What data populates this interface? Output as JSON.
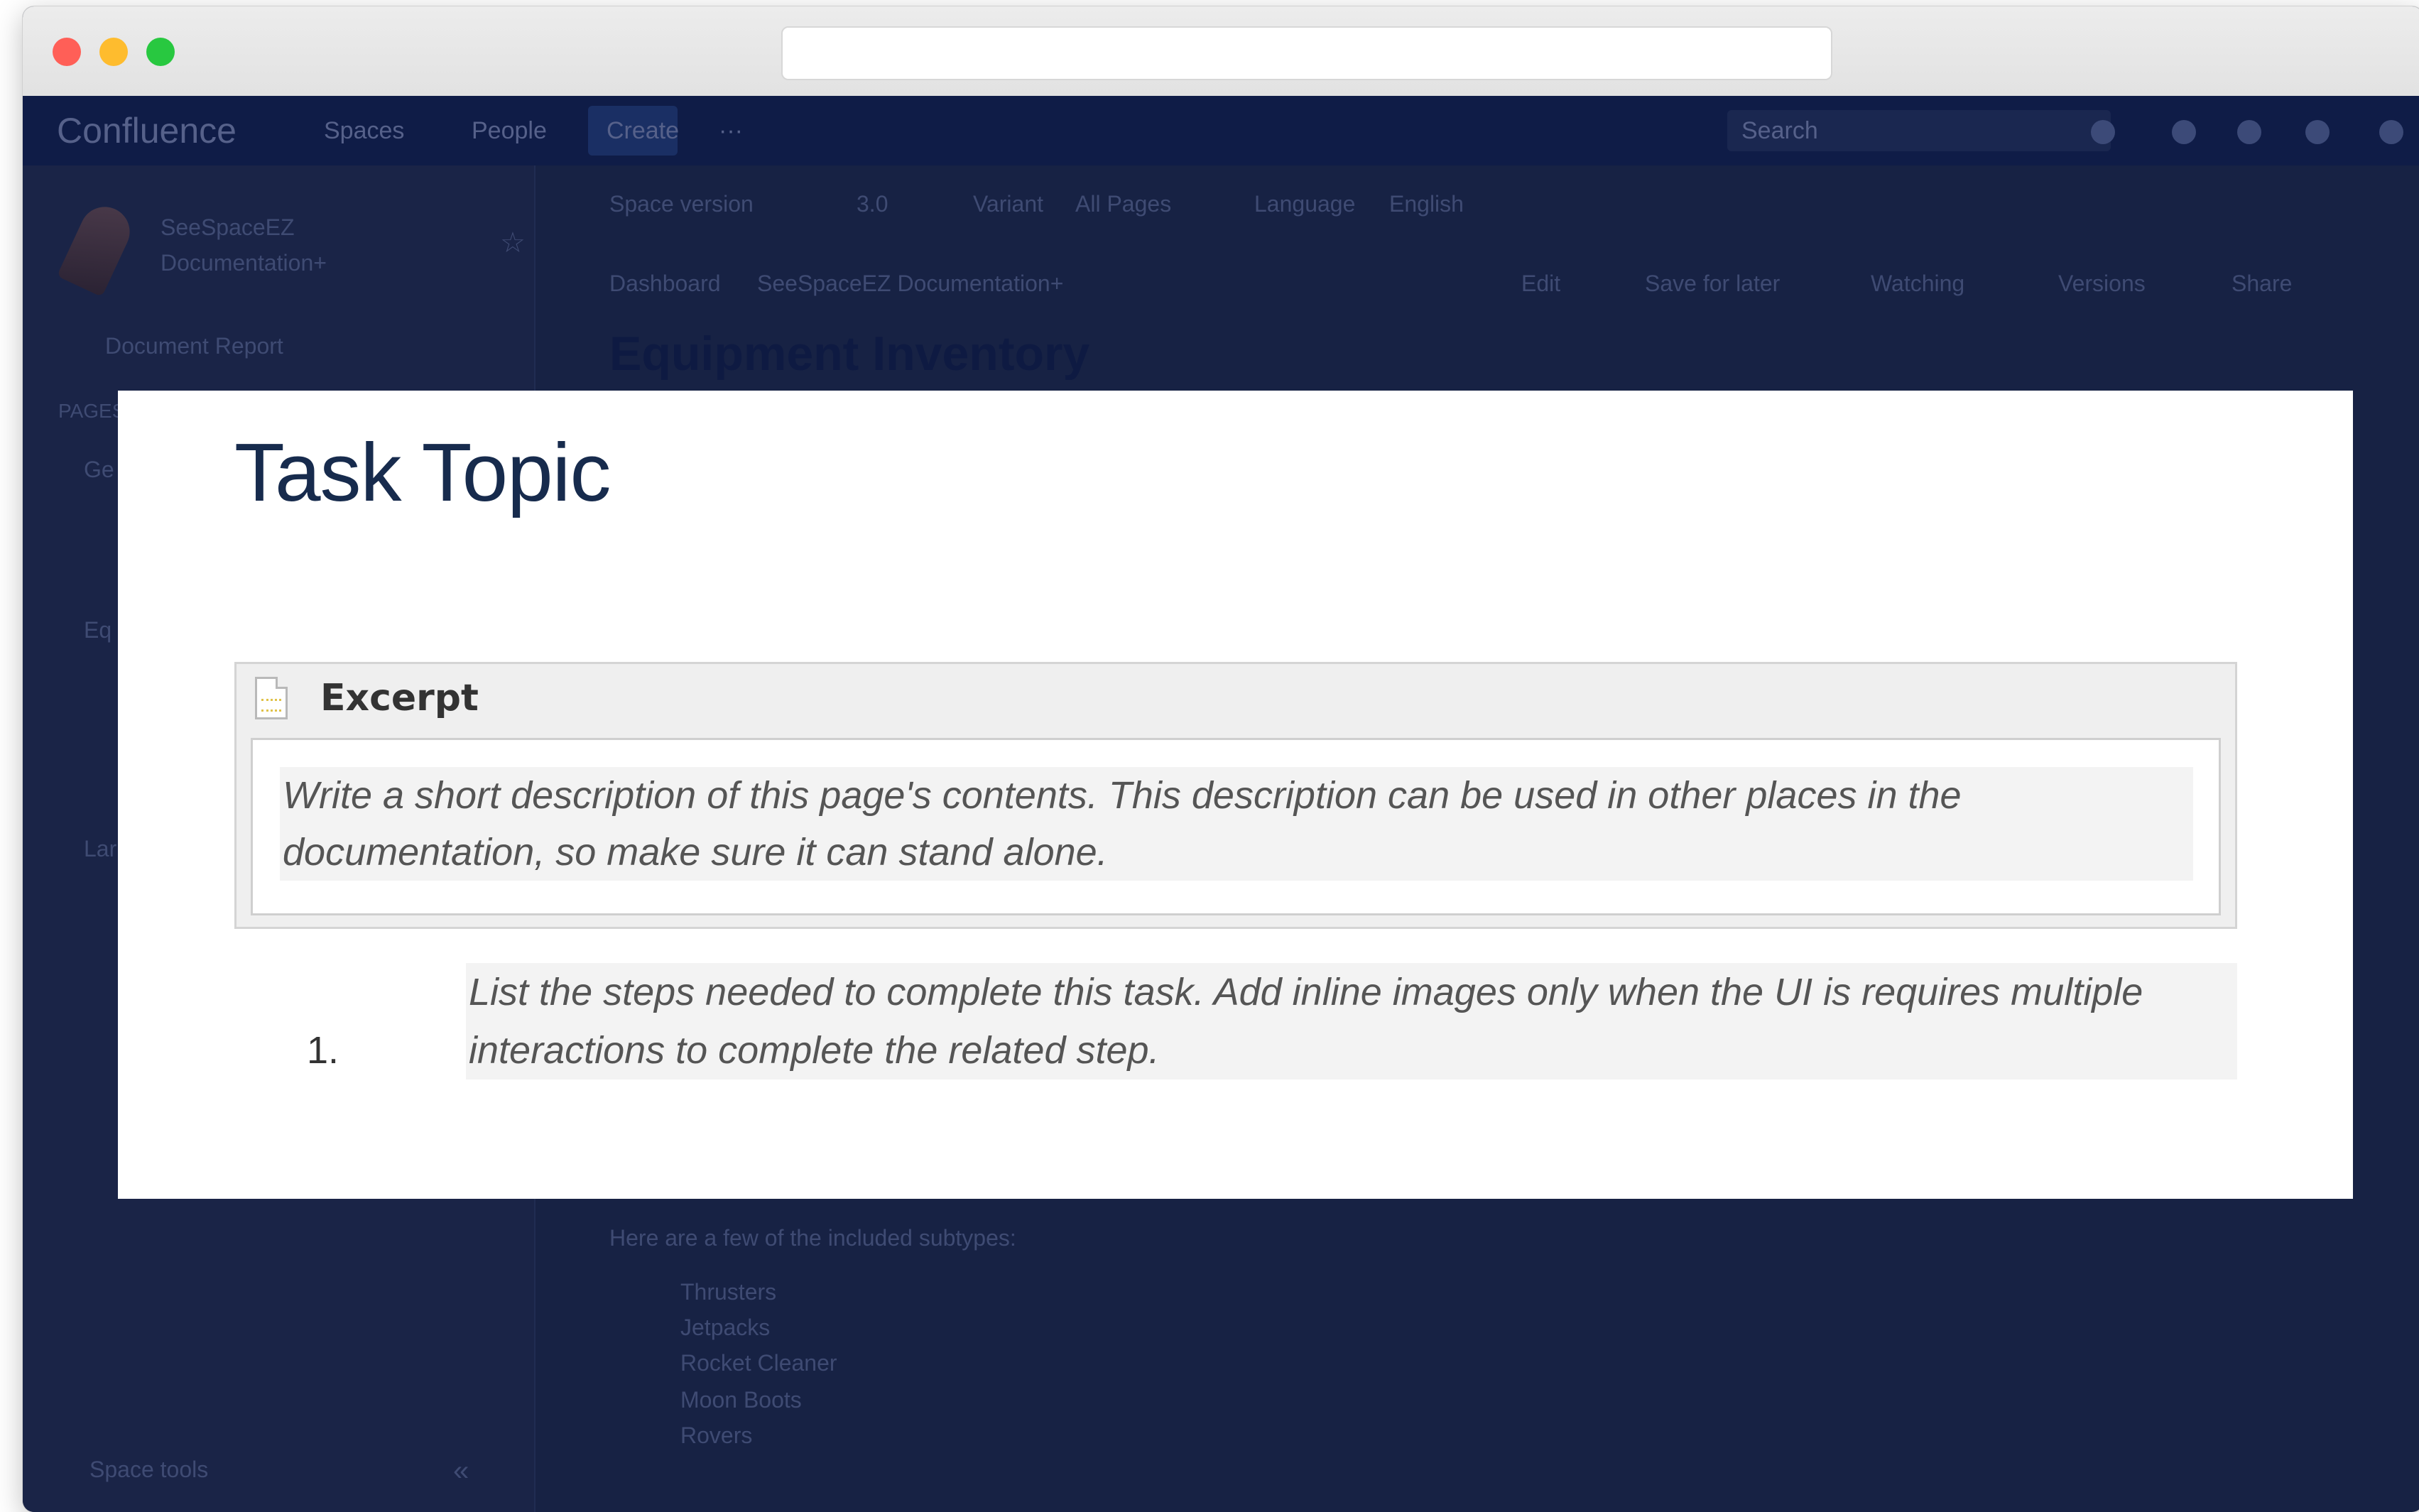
{
  "app": {
    "name": "Confluence",
    "nav": [
      "Spaces",
      "People"
    ],
    "create_label": "Create",
    "more_label": "···",
    "search_placeholder": "Search"
  },
  "sidebar": {
    "space_name": "SeeSpaceEZ Documentation+",
    "document_report": "Document Report",
    "pages_heading": "PAGES",
    "tree_fragments": [
      "Ge",
      "Eq",
      "Lar"
    ],
    "space_tools": "Space tools",
    "collapse_label": "«"
  },
  "toolbar": {
    "space_version_label": "Space version",
    "version": "3.0",
    "variant_label": "Variant",
    "variant": "All Pages",
    "language_label": "Language",
    "language": "English"
  },
  "breadcrumb": [
    "Dashboard",
    "SeeSpaceEZ Documentation+"
  ],
  "actions": [
    "Edit",
    "Save for later",
    "Watching",
    "Versions",
    "Share"
  ],
  "page": {
    "title": "Equipment Inventory",
    "subtypes_intro": "Here are a few of the included subtypes:",
    "subtypes": [
      "Thrusters",
      "Jetpacks",
      "Rocket Cleaner",
      "Moon Boots",
      "Rovers"
    ]
  },
  "modal": {
    "title": "Task Topic",
    "excerpt_label": "Excerpt",
    "excerpt_text": "Write a short description of this page's contents. This description can be used in other places in the documentation, so make sure it can stand alone.",
    "steps": [
      {
        "number": "1.",
        "text": "List the steps needed to complete this task. Add inline images only when the UI is requires multiple interactions to complete the related step."
      }
    ]
  }
}
